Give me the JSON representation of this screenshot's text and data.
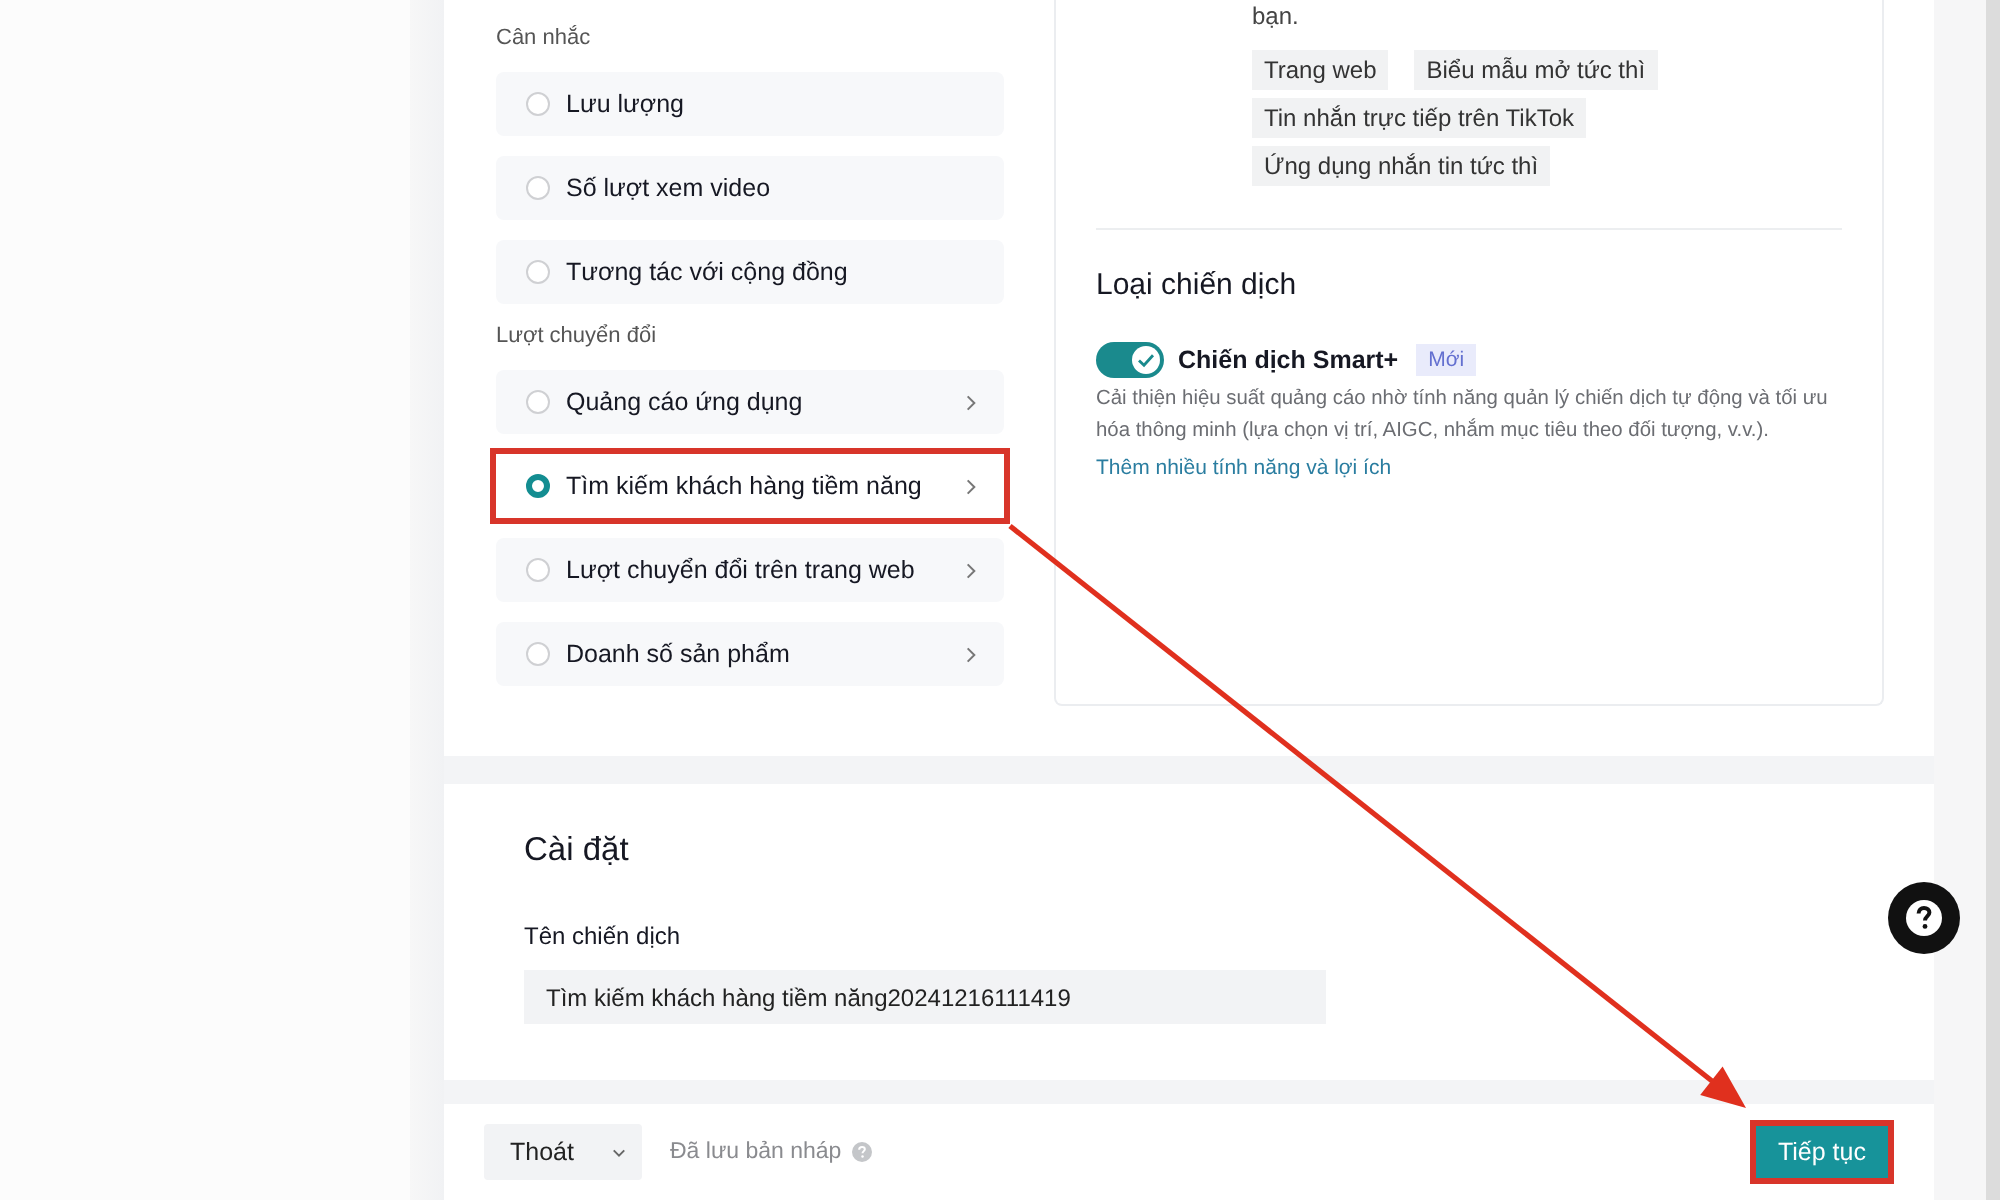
{
  "objective_groups": [
    {
      "label": "Cân nhắc",
      "options": [
        {
          "label": "Lưu lượng",
          "selected": false,
          "has_submenu": false,
          "highlighted": false
        },
        {
          "label": "Số lượt xem video",
          "selected": false,
          "has_submenu": false,
          "highlighted": false
        },
        {
          "label": "Tương tác với cộng đồng",
          "selected": false,
          "has_submenu": false,
          "highlighted": false
        }
      ]
    },
    {
      "label": "Lượt chuyển đổi",
      "options": [
        {
          "label": "Quảng cáo ứng dụng",
          "selected": false,
          "has_submenu": true,
          "highlighted": false
        },
        {
          "label": "Tìm kiếm khách hàng tiềm năng",
          "selected": true,
          "has_submenu": true,
          "highlighted": true
        },
        {
          "label": "Lượt chuyển đổi trên trang web",
          "selected": false,
          "has_submenu": true,
          "highlighted": false
        },
        {
          "label": "Doanh số sản phẩm",
          "selected": false,
          "has_submenu": true,
          "highlighted": false
        }
      ]
    }
  ],
  "objective_details": {
    "description_tail": "bạn.",
    "tags": [
      "Trang web",
      "Biểu mẫu mở tức thì",
      "Tin nhắn trực tiếp trên TikTok",
      "Ứng dụng nhắn tin tức thì"
    ]
  },
  "campaign_type": {
    "title": "Loại chiến dịch",
    "toggle": {
      "label": "Chiến dịch Smart+",
      "on": true,
      "badge": "Mới"
    },
    "description": "Cải thiện hiệu suất quảng cáo nhờ tính năng quản lý chiến dịch tự động và tối ưu hóa thông minh (lựa chọn vị trí, AIGC, nhắm mục tiêu theo đối tượng, v.v.).",
    "link": "Thêm nhiều tính năng và lợi ích"
  },
  "settings": {
    "title": "Cài đặt",
    "campaign_name": {
      "label": "Tên chiến dịch",
      "value": "Tìm kiếm khách hàng tiềm năng20241216111419"
    }
  },
  "footer": {
    "exit_button": "Thoát",
    "draft_status": "Đã lưu bản nháp",
    "continue_button": {
      "label": "Tiếp tục",
      "highlighted": true
    }
  },
  "annotation_arrow": true
}
